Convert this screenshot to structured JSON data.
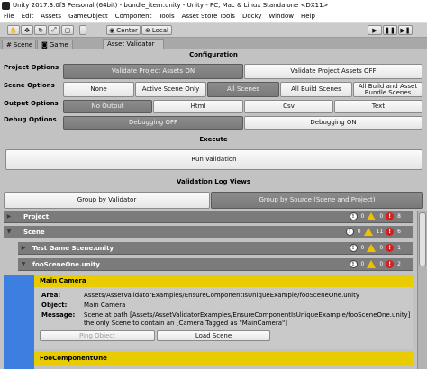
{
  "window": {
    "title": "Unity 2017.3.0f3 Personal (64bit) - bundle_item.unity - Unity - PC, Mac & Linux Standalone <DX11>"
  },
  "menu": [
    "File",
    "Edit",
    "Assets",
    "GameObject",
    "Component",
    "Tools",
    "Asset Store Tools",
    "Docky",
    "Window",
    "Help"
  ],
  "toolbar": {
    "center_label": "Center",
    "local_label": "Local"
  },
  "tabs": {
    "scene": "Scene",
    "game": "Game",
    "validator": "Asset Validator"
  },
  "configuration": {
    "title": "Configuration",
    "project_options": {
      "label": "Project Options",
      "opt1": "Validate Project Assets ON",
      "opt2": "Validate Project Assets OFF"
    },
    "scene_options": {
      "label": "Scene Options",
      "opt1": "None",
      "opt2": "Active Scene Only",
      "opt3": "All Scenes",
      "opt4": "All Build Scenes",
      "opt5": "All Build and Asset Bundle Scenes"
    },
    "output_options": {
      "label": "Output Options",
      "opt1": "No Output",
      "opt2": "Html",
      "opt3": "Csv",
      "opt4": "Text"
    },
    "debug_options": {
      "label": "Debug Options",
      "opt1": "Debugging OFF",
      "opt2": "Debugging ON"
    }
  },
  "execute": {
    "title": "Execute",
    "run_label": "Run Validation"
  },
  "log_views": {
    "title": "Validation Log Views",
    "group_validator": "Group by Validator",
    "group_source": "Group by Source (Scene and Project)"
  },
  "tree": {
    "project": {
      "label": "Project",
      "info": "0",
      "warn": "0",
      "err": "8"
    },
    "scene": {
      "label": "Scene",
      "info": "0",
      "warn": "11",
      "err": "6"
    },
    "test_scene": {
      "label": "Test Game Scene.unity",
      "info": "0",
      "warn": "0",
      "err": "1"
    },
    "foo_scene": {
      "label": "fooSceneOne.unity",
      "info": "0",
      "warn": "0",
      "err": "2"
    }
  },
  "main_camera": {
    "header": "Main Camera",
    "area_label": "Area:",
    "area_value": "Assets/AssetValidatorExamples/EnsureComponentIsUniqueExample/fooSceneOne.unity",
    "object_label": "Object:",
    "object_value": "Main Camera",
    "message_label": "Message:",
    "message_line1": "Scene at path [Assets/AssetValidatorExamples/EnsureComponentIsUniqueExample/fooSceneOne.unity] is n",
    "message_line2": "the only Scene to contain an [Camera Tagged as \"MainCamera\"]",
    "ping_label": "Ping Object",
    "load_label": "Load Scene"
  },
  "foo_component": {
    "header": "FooComponentOne"
  },
  "colors": {
    "accent_blue": "#3d7fe0",
    "highlight_yellow": "#e8cc00",
    "selected_button": "#858585"
  }
}
